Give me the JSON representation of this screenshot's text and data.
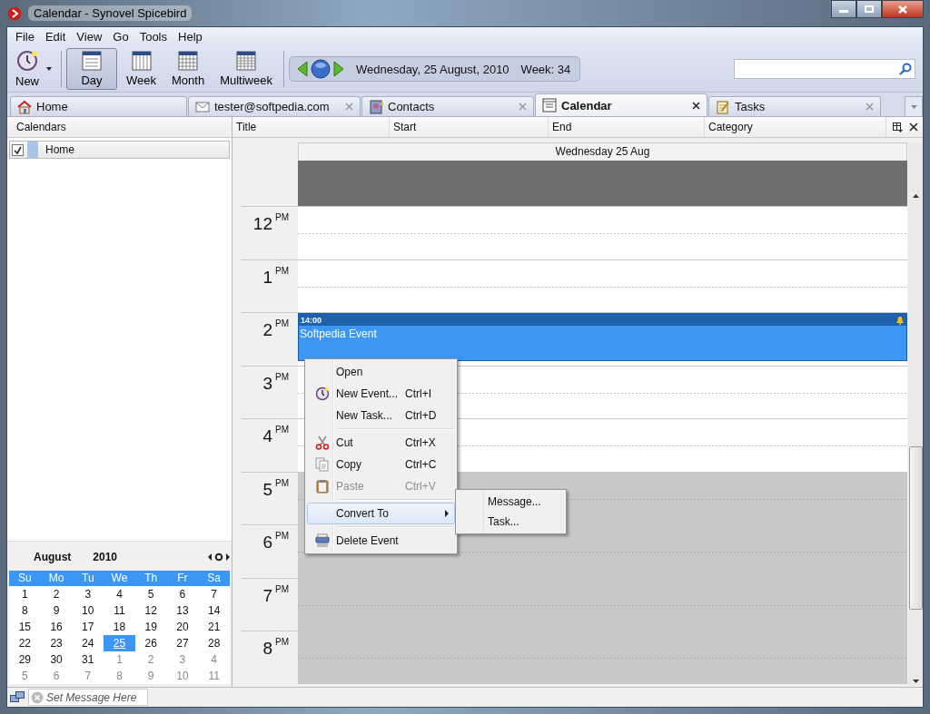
{
  "window": {
    "title": "Calendar - Synovel Spicebird"
  },
  "menu": [
    "File",
    "Edit",
    "View",
    "Go",
    "Tools",
    "Help"
  ],
  "toolbar": {
    "new_button": {
      "label": "New"
    },
    "views": [
      {
        "label": "Day",
        "selected": true
      },
      {
        "label": "Week",
        "selected": false
      },
      {
        "label": "Month",
        "selected": false
      },
      {
        "label": "Multiweek",
        "selected": false
      }
    ],
    "date": "Wednesday, 25 August, 2010",
    "week": "Week: 34"
  },
  "tabs": [
    {
      "kind": "home",
      "label": "Home",
      "selected": false,
      "closable": false
    },
    {
      "kind": "mail",
      "label": "tester@softpedia.com",
      "selected": false,
      "closable": true
    },
    {
      "kind": "contacts",
      "label": "Contacts",
      "selected": false,
      "closable": true
    },
    {
      "kind": "calendar",
      "label": "Calendar",
      "selected": true,
      "closable": true
    },
    {
      "kind": "tasks",
      "label": "Tasks",
      "selected": false,
      "closable": true
    }
  ],
  "sidebar": {
    "header": "Calendars",
    "calendars": [
      {
        "name": "Home",
        "checked": true,
        "color": "#a8c4e8"
      }
    ]
  },
  "mini_calendar": {
    "month": "August",
    "year": "2010",
    "weekdays": [
      "Su",
      "Mo",
      "Tu",
      "We",
      "Th",
      "Fr",
      "Sa"
    ],
    "weeks": [
      [
        {
          "day": "1",
          "other_month": false,
          "selected": false
        },
        {
          "day": "2",
          "other_month": false,
          "selected": false
        },
        {
          "day": "3",
          "other_month": false,
          "selected": false
        },
        {
          "day": "4",
          "other_month": false,
          "selected": false
        },
        {
          "day": "5",
          "other_month": false,
          "selected": false
        },
        {
          "day": "6",
          "other_month": false,
          "selected": false
        },
        {
          "day": "7",
          "other_month": false,
          "selected": false
        }
      ],
      [
        {
          "day": "8",
          "other_month": false,
          "selected": false
        },
        {
          "day": "9",
          "other_month": false,
          "selected": false
        },
        {
          "day": "10",
          "other_month": false,
          "selected": false
        },
        {
          "day": "11",
          "other_month": false,
          "selected": false
        },
        {
          "day": "12",
          "other_month": false,
          "selected": false
        },
        {
          "day": "13",
          "other_month": false,
          "selected": false
        },
        {
          "day": "14",
          "other_month": false,
          "selected": false
        }
      ],
      [
        {
          "day": "15",
          "other_month": false,
          "selected": false
        },
        {
          "day": "16",
          "other_month": false,
          "selected": false
        },
        {
          "day": "17",
          "other_month": false,
          "selected": false
        },
        {
          "day": "18",
          "other_month": false,
          "selected": false
        },
        {
          "day": "19",
          "other_month": false,
          "selected": false
        },
        {
          "day": "20",
          "other_month": false,
          "selected": false
        },
        {
          "day": "21",
          "other_month": false,
          "selected": false
        }
      ],
      [
        {
          "day": "22",
          "other_month": false,
          "selected": false
        },
        {
          "day": "23",
          "other_month": false,
          "selected": false
        },
        {
          "day": "24",
          "other_month": false,
          "selected": false
        },
        {
          "day": "25",
          "other_month": false,
          "selected": true
        },
        {
          "day": "26",
          "other_month": false,
          "selected": false
        },
        {
          "day": "27",
          "other_month": false,
          "selected": false
        },
        {
          "day": "28",
          "other_month": false,
          "selected": false
        }
      ],
      [
        {
          "day": "29",
          "other_month": false,
          "selected": false
        },
        {
          "day": "30",
          "other_month": false,
          "selected": false
        },
        {
          "day": "31",
          "other_month": false,
          "selected": false
        },
        {
          "day": "1",
          "other_month": true,
          "selected": false
        },
        {
          "day": "2",
          "other_month": true,
          "selected": false
        },
        {
          "day": "3",
          "other_month": true,
          "selected": false
        },
        {
          "day": "4",
          "other_month": true,
          "selected": false
        }
      ],
      [
        {
          "day": "5",
          "other_month": true,
          "selected": false
        },
        {
          "day": "6",
          "other_month": true,
          "selected": false
        },
        {
          "day": "7",
          "other_month": true,
          "selected": false
        },
        {
          "day": "8",
          "other_month": true,
          "selected": false
        },
        {
          "day": "9",
          "other_month": true,
          "selected": false
        },
        {
          "day": "10",
          "other_month": true,
          "selected": false
        },
        {
          "day": "11",
          "other_month": true,
          "selected": false
        }
      ]
    ]
  },
  "task_columns": [
    "Title",
    "Start",
    "End",
    "Category"
  ],
  "day_view": {
    "day_header": "Wednesday 25 Aug",
    "hours": [
      {
        "hour": "12",
        "period": "PM",
        "off_hours": false
      },
      {
        "hour": "1",
        "period": "PM",
        "off_hours": false
      },
      {
        "hour": "2",
        "period": "PM",
        "off_hours": false,
        "event": {
          "time": "14:00",
          "title": "Softpedia Event",
          "alarm": true
        }
      },
      {
        "hour": "3",
        "period": "PM",
        "off_hours": false
      },
      {
        "hour": "4",
        "period": "PM",
        "off_hours": false
      },
      {
        "hour": "5",
        "period": "PM",
        "off_hours": true
      },
      {
        "hour": "6",
        "period": "PM",
        "off_hours": true
      },
      {
        "hour": "7",
        "period": "PM",
        "off_hours": true
      },
      {
        "hour": "8",
        "period": "PM",
        "off_hours": true
      }
    ]
  },
  "context_menu": {
    "items": [
      {
        "kind": "item",
        "label": "Open",
        "disabled": false,
        "selected": false,
        "submenu": false
      },
      {
        "kind": "item",
        "label": "New Event...",
        "shortcut": "Ctrl+I",
        "disabled": false,
        "selected": false,
        "submenu": false
      },
      {
        "kind": "item",
        "label": "New Task...",
        "shortcut": "Ctrl+D",
        "disabled": false,
        "selected": false,
        "submenu": false
      },
      {
        "kind": "separator"
      },
      {
        "kind": "item",
        "label": "Cut",
        "shortcut": "Ctrl+X",
        "disabled": false,
        "selected": false,
        "submenu": false
      },
      {
        "kind": "item",
        "label": "Copy",
        "shortcut": "Ctrl+C",
        "disabled": false,
        "selected": false,
        "submenu": false
      },
      {
        "kind": "item",
        "label": "Paste",
        "shortcut": "Ctrl+V",
        "disabled": true,
        "selected": false,
        "submenu": false
      },
      {
        "kind": "separator"
      },
      {
        "kind": "item",
        "label": "Convert To",
        "disabled": false,
        "selected": true,
        "submenu": true
      },
      {
        "kind": "separator"
      },
      {
        "kind": "item",
        "label": "Delete Event",
        "disabled": false,
        "selected": false,
        "submenu": false
      }
    ],
    "submenu": [
      "Message...",
      "Task..."
    ]
  },
  "status_bar": {
    "message_placeholder": "Set Message Here"
  }
}
